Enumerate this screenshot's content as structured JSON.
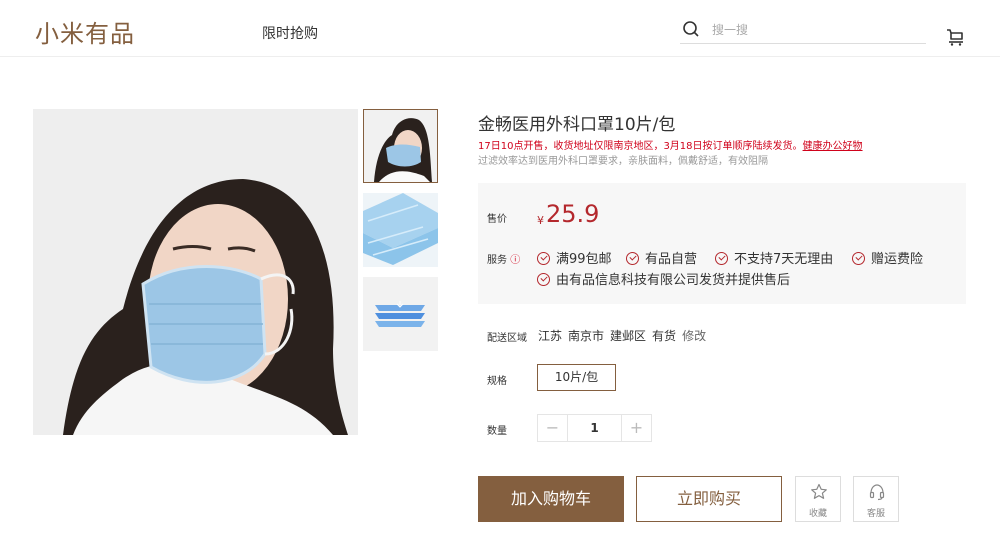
{
  "header": {
    "logo": "小米有品",
    "nav_flash_sale": "限时抢购",
    "search_placeholder": "搜一搜"
  },
  "gallery": {
    "main_image": "woman-wearing-blue-mask",
    "thumbnails": [
      "woman-wearing-mask",
      "stacked-masks",
      "mask-layers-diagram"
    ]
  },
  "product": {
    "title": "金畅医用外科口罩10片/包",
    "notice": "17日10点开售，收货地址仅限南京地区，3月18日按订单顺序陆续发货。",
    "notice_link": "健康办公好物",
    "subtitle": "过滤效率达到医用外科口罩要求，亲肤面料，佩戴舒适，有效阻隔"
  },
  "price_box": {
    "price_label": "售价",
    "currency": "¥",
    "price": "25.9",
    "service_label": "服务",
    "service_info": "ⓘ",
    "services": [
      "满99包邮",
      "有品自营",
      "不支持7天无理由",
      "赠运费险",
      "由有品信息科技有限公司发货并提供售后"
    ]
  },
  "delivery": {
    "label": "配送区域",
    "province": "江苏",
    "city": "南京市",
    "district": "建邺区",
    "stock": "有货",
    "edit": "修改"
  },
  "spec": {
    "label": "规格",
    "selected": "10片/包"
  },
  "quantity": {
    "label": "数量",
    "minus": "−",
    "value": "1",
    "plus": "+"
  },
  "actions": {
    "add_to_cart": "加入购物车",
    "buy_now": "立即购买",
    "favorite": "收藏",
    "service": "客服"
  },
  "colors": {
    "brand": "#845f3f",
    "price": "#b4282d",
    "notice": "#d0021b"
  }
}
